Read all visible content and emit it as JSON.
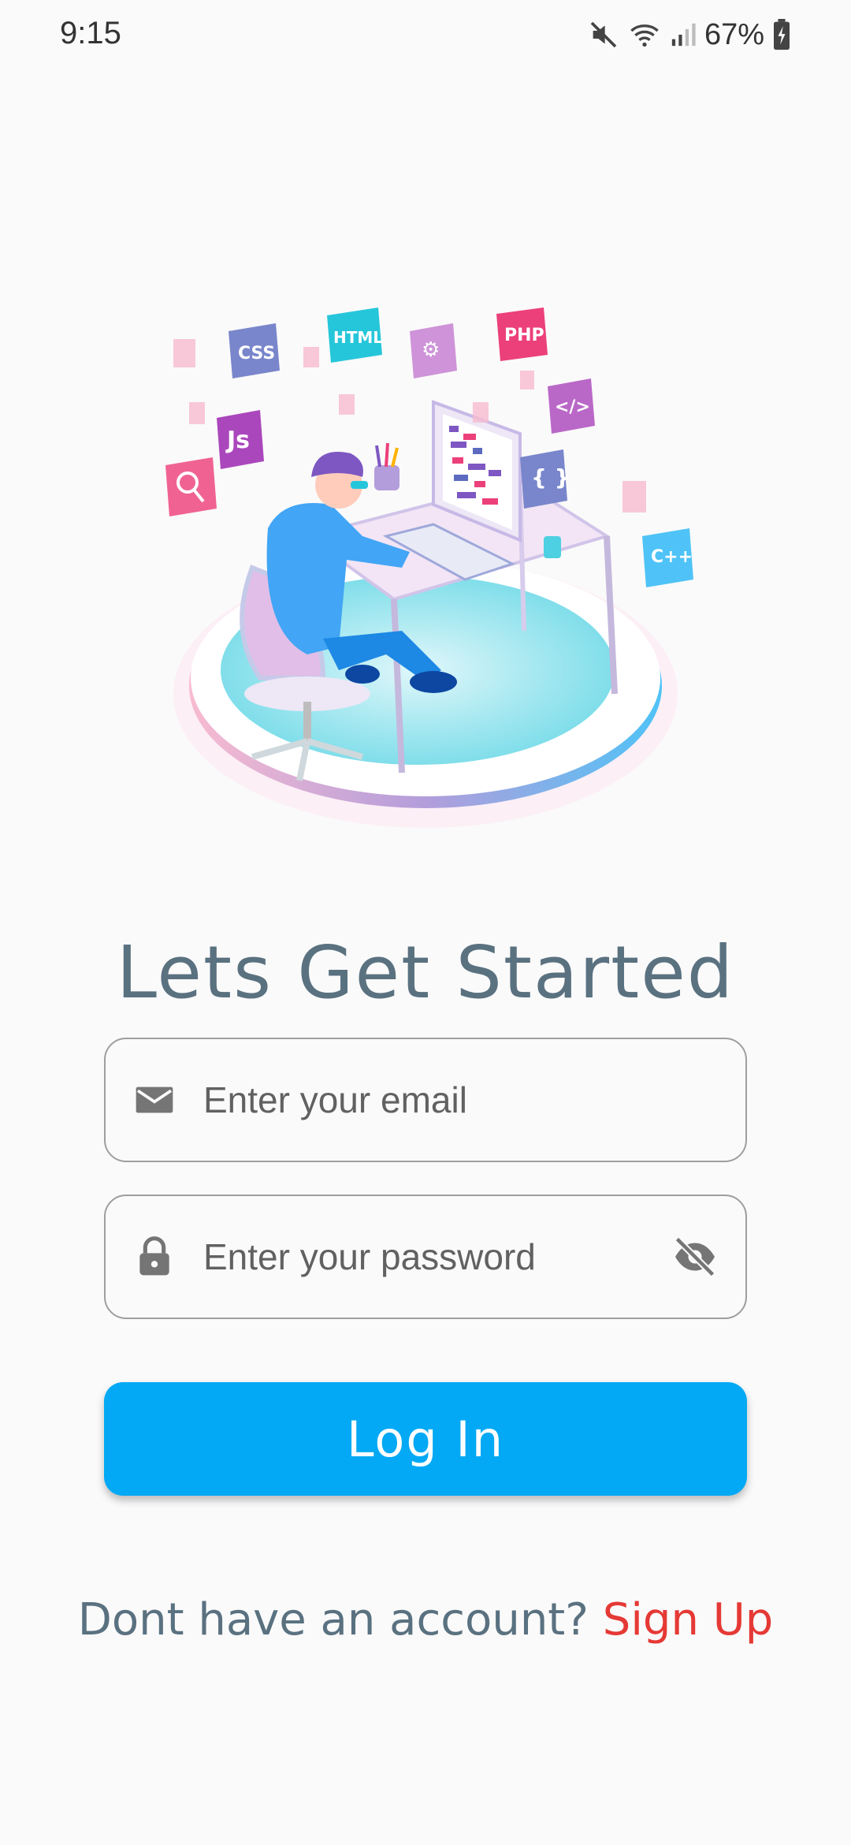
{
  "status_bar": {
    "time": "9:15",
    "battery": "67%",
    "icons": [
      "mute-icon",
      "wifi-icon",
      "signal-icon",
      "battery-icon"
    ]
  },
  "illustration": {
    "tags": [
      "CSS",
      "HTML",
      "PHP",
      "Js",
      "{ }",
      "</>",
      "C++"
    ]
  },
  "headline": "Lets Get Started",
  "email": {
    "placeholder": "Enter your email",
    "icon": "mail-icon"
  },
  "password": {
    "placeholder": "Enter your password",
    "icon": "lock-icon",
    "toggle_icon": "eye-off-icon"
  },
  "login_button": "Log In",
  "signup": {
    "prompt": "Dont have an account?",
    "link": "Sign Up"
  },
  "colors": {
    "primary": "#03a9f4",
    "headline": "#5a7180",
    "link": "#e53935",
    "background": "#fafafa"
  }
}
